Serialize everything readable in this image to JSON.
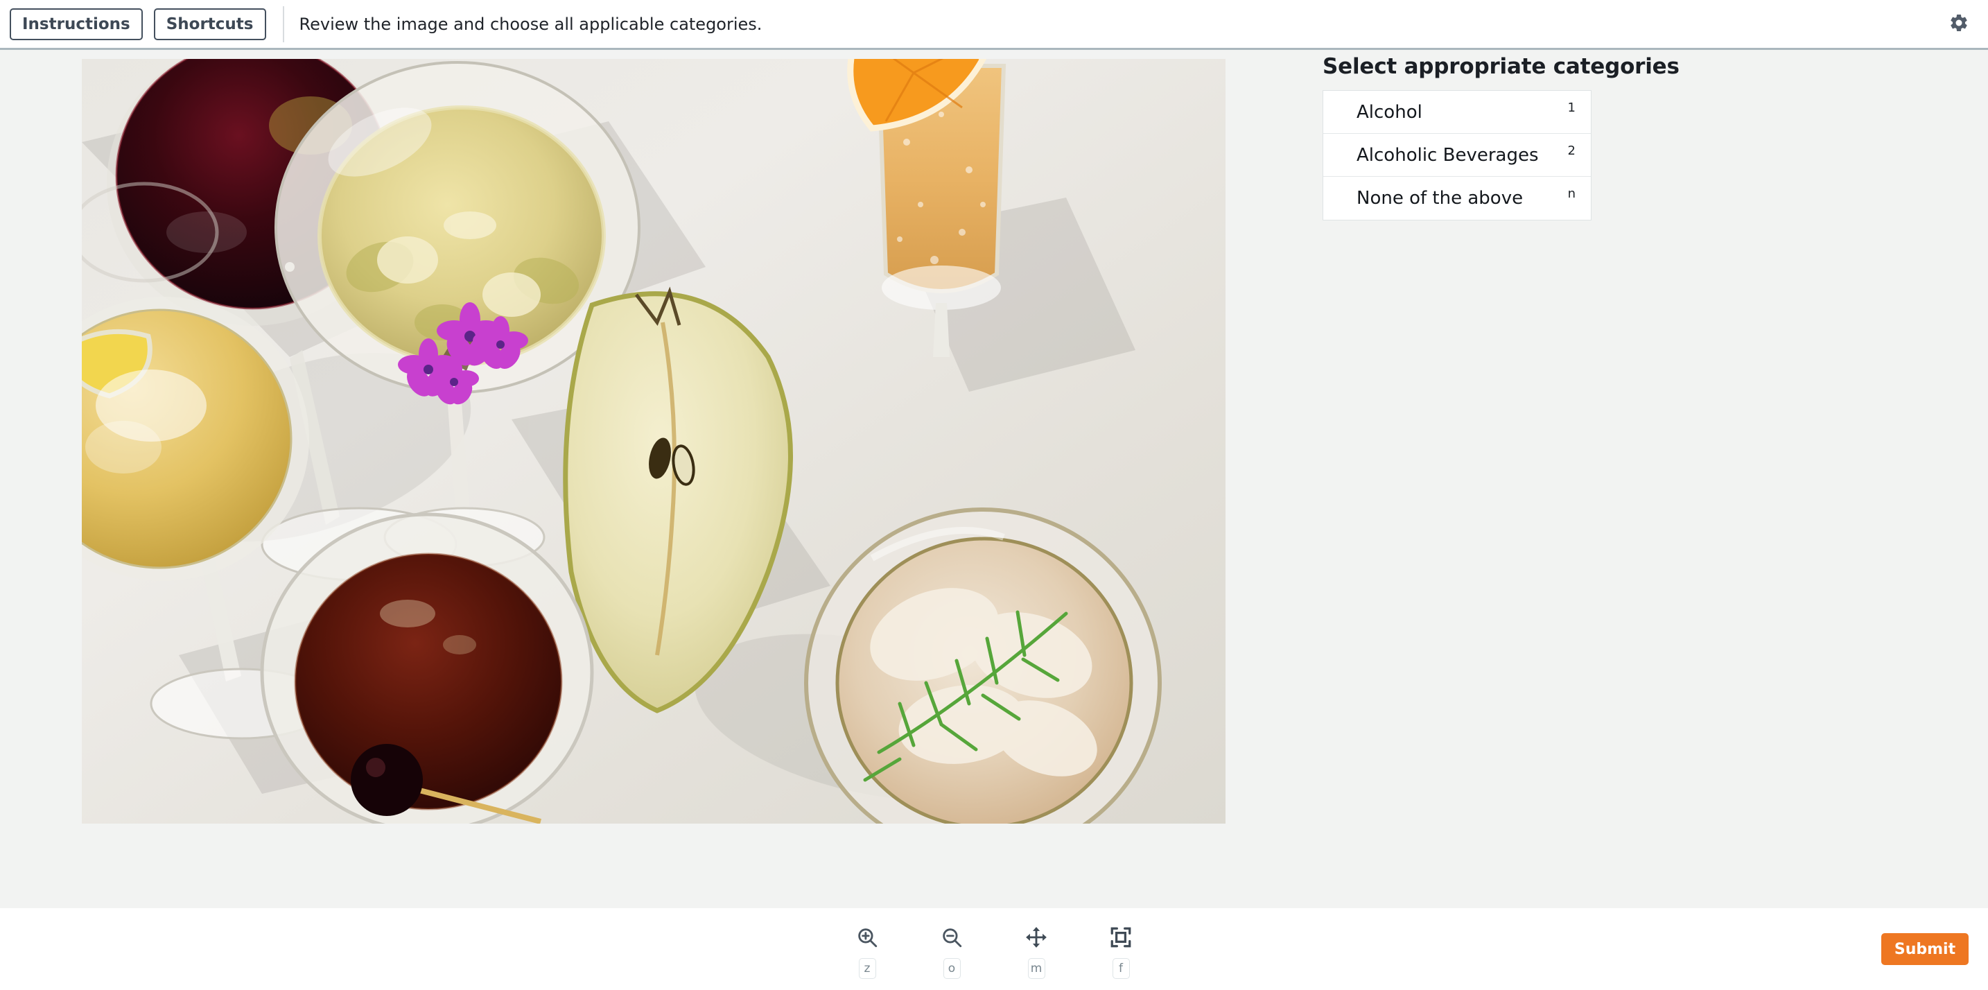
{
  "header": {
    "instructions_label": "Instructions",
    "shortcuts_label": "Shortcuts",
    "instruction_text": "Review the image and choose all applicable categories.",
    "settings_icon": "gear-icon"
  },
  "main": {
    "image": {
      "alt": "Overhead photo of assorted alcoholic cocktails and wine glasses on a white table with a halved pear, purple flowers, orange slice and dill garnish",
      "icon": "photo"
    },
    "categories_panel": {
      "title": "Select appropriate categories",
      "items": [
        {
          "label": "Alcohol",
          "shortcut": "1",
          "selected": false
        },
        {
          "label": "Alcoholic Beverages",
          "shortcut": "2",
          "selected": false
        },
        {
          "label": "None of the above",
          "shortcut": "n",
          "selected": false
        }
      ]
    }
  },
  "footer": {
    "tools": [
      {
        "name": "zoom-in",
        "icon": "magnifier-plus-icon",
        "shortcut": "z"
      },
      {
        "name": "zoom-out",
        "icon": "magnifier-minus-icon",
        "shortcut": "o"
      },
      {
        "name": "move",
        "icon": "move-arrows-icon",
        "shortcut": "m"
      },
      {
        "name": "fit",
        "icon": "fit-to-screen-icon",
        "shortcut": "f"
      }
    ],
    "submit_label": "Submit"
  },
  "colors": {
    "accent_orange": "#ee7722",
    "page_background": "#f2f3f2",
    "border_gray": "#aab7bd",
    "text_dark": "#20242a"
  }
}
